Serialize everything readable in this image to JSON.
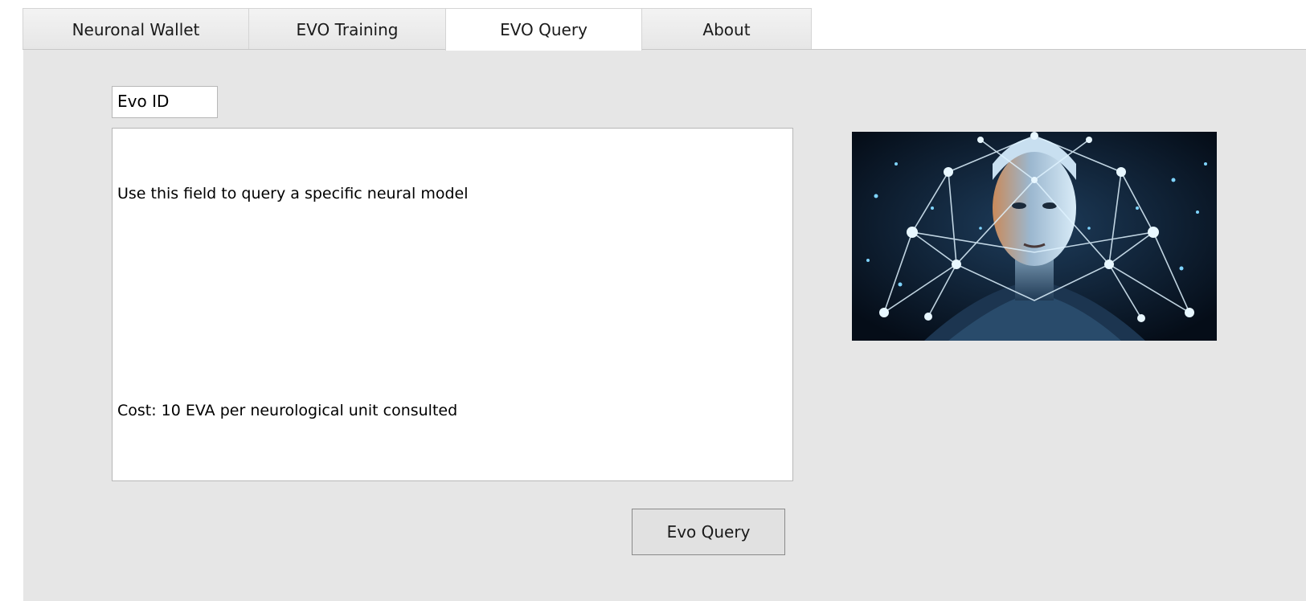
{
  "tabs": [
    {
      "label": "Neuronal Wallet",
      "active": false
    },
    {
      "label": "EVO Training",
      "active": false
    },
    {
      "label": "EVO Query",
      "active": true
    },
    {
      "label": "About",
      "active": false
    }
  ],
  "evo_id": {
    "value": "Evo ID"
  },
  "query_area": {
    "lines": [
      "Use this field to query a specific neural model",
      "",
      "",
      "Cost: 10 EVA per neurological unit consulted"
    ]
  },
  "image": {
    "icon": "neural-face-illustration"
  },
  "query_button": {
    "label": "Evo Query"
  },
  "colors": {
    "panel": "#e6e6e6",
    "image_bg": "#0b1b2e",
    "network": "#7fd4ff"
  }
}
